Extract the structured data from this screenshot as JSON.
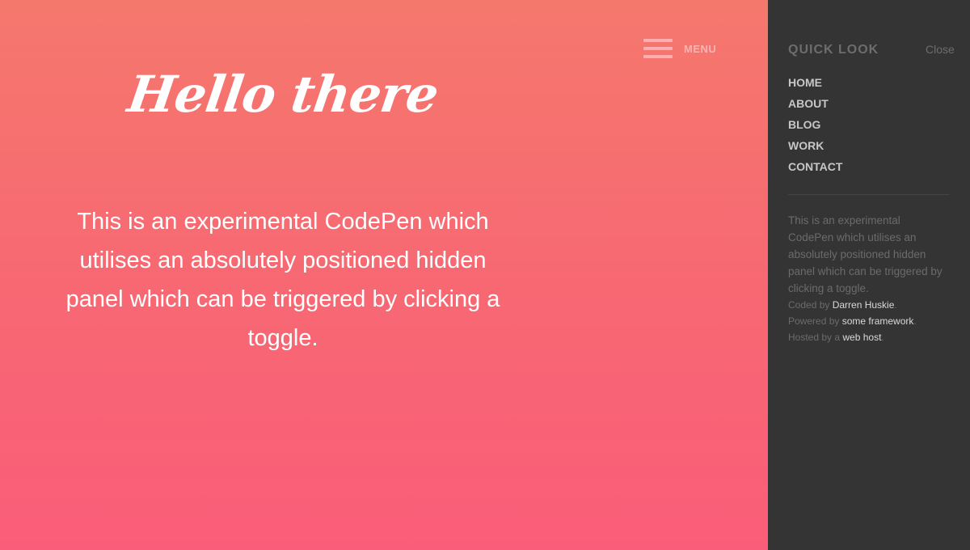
{
  "colors": {
    "gradient_top": "#f5786d",
    "gradient_bottom": "#fa5d79",
    "panel_bg": "#343434",
    "heading_text": "#ffffff",
    "muted_text": "#6d6d6d",
    "nav_text": "#c7c7c7"
  },
  "header": {
    "menu_icon": "hamburger-icon",
    "menu_label": "MENU"
  },
  "main": {
    "title": "Hello there",
    "intro_lines": [
      "This is an experimental CodePen which",
      "utilises an absolutely positioned hidden",
      "panel which can be triggered by clicking a",
      "toggle."
    ]
  },
  "panel": {
    "title": "QUICK LOOK",
    "close_label": "Close",
    "nav": [
      {
        "label": "HOME"
      },
      {
        "label": "ABOUT"
      },
      {
        "label": "BLOG"
      },
      {
        "label": "WORK"
      },
      {
        "label": "CONTACT"
      }
    ],
    "description_lines": [
      "This is an experimental",
      "CodePen which utilises an",
      "absolutely positioned hidden",
      "panel which can be triggered by",
      "clicking a toggle."
    ],
    "credits": [
      {
        "prefix": "Coded by ",
        "link": "Darren Huskie",
        "suffix": "."
      },
      {
        "prefix": "Powered by ",
        "link": "some framework",
        "suffix": "."
      },
      {
        "prefix": "Hosted by a ",
        "link": "web host",
        "suffix": "."
      }
    ]
  }
}
